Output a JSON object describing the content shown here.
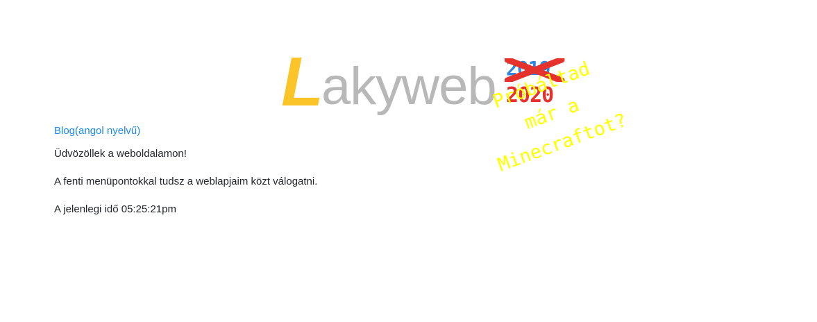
{
  "logo": {
    "letter": "L",
    "rest": "akyweb",
    "year_old": "2019",
    "year_new": "2020"
  },
  "splash": {
    "line1": "Próbáltad",
    "line2": "már a",
    "line3": "Minecraftot?"
  },
  "nav": {
    "blog_label": "Blog(angol nyelvű)"
  },
  "main": {
    "welcome": "Üdvözöllek a weboldalamon!",
    "instructions": "A fenti menüpontokkal tudsz a weblapjaim közt válogatni.",
    "time_text": "A jelenlegi idő 05:25:21pm"
  },
  "colors": {
    "logo_L": "#fbc529",
    "logo_text": "#b8b8b8",
    "year_old": "#2e86de",
    "year_new": "#e5322d",
    "splash": "#ffff00",
    "link": "#1e88e5",
    "text": "#212529"
  }
}
